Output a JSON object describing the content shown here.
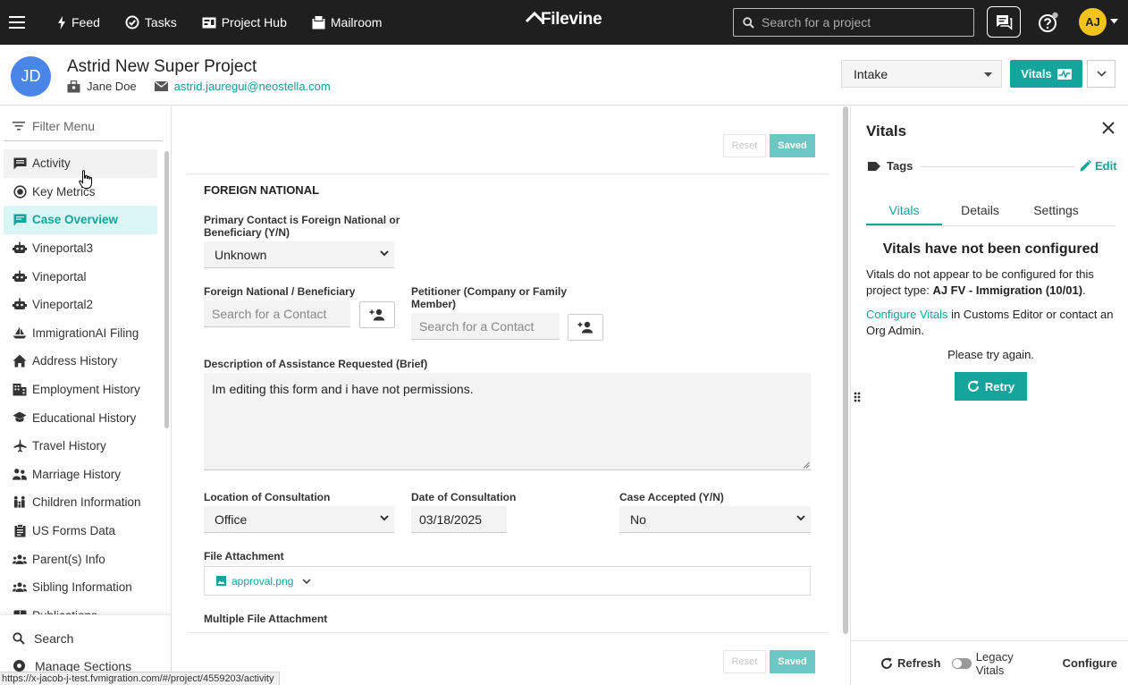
{
  "topnav": {
    "links": [
      {
        "label": "Feed",
        "icon": "bolt-icon"
      },
      {
        "label": "Tasks",
        "icon": "check-circle-icon"
      },
      {
        "label": "Project Hub",
        "icon": "id-card-icon"
      },
      {
        "label": "Mailroom",
        "icon": "mailroom-icon"
      }
    ],
    "logo_text": "Filevine",
    "search_placeholder": "Search for a project",
    "user_initials": "AJ"
  },
  "project": {
    "avatar_initials": "JD",
    "title": "Astrid New Super Project",
    "client": "Jane Doe",
    "email": "astrid.jauregui@neostella.com",
    "phase": "Intake",
    "vitals_button": "Vitals"
  },
  "sidebar": {
    "filter_placeholder": "Filter Menu",
    "items": [
      {
        "label": "Activity",
        "icon": "chat-icon",
        "state": "hover"
      },
      {
        "label": "Key Metrics",
        "icon": "target-icon",
        "state": ""
      },
      {
        "label": "Case Overview",
        "icon": "comment-icon",
        "state": "active"
      },
      {
        "label": "Vineportal3",
        "icon": "robot-icon",
        "state": ""
      },
      {
        "label": "Vineportal",
        "icon": "robot-icon",
        "state": ""
      },
      {
        "label": "Vineportal2",
        "icon": "robot-icon",
        "state": ""
      },
      {
        "label": "ImmigrationAI Filing",
        "icon": "ship-icon",
        "state": ""
      },
      {
        "label": "Address History",
        "icon": "home-icon",
        "state": ""
      },
      {
        "label": "Employment History",
        "icon": "building-icon",
        "state": ""
      },
      {
        "label": "Educational History",
        "icon": "graduation-cap-icon",
        "state": ""
      },
      {
        "label": "Travel History",
        "icon": "airplane-icon",
        "state": ""
      },
      {
        "label": "Marriage History",
        "icon": "people-icon",
        "state": ""
      },
      {
        "label": "Children Information",
        "icon": "family-icon",
        "state": ""
      },
      {
        "label": "US Forms Data",
        "icon": "clipboard-icon",
        "state": ""
      },
      {
        "label": "Parent(s) Info",
        "icon": "group-icon",
        "state": ""
      },
      {
        "label": "Sibling Information",
        "icon": "group-icon",
        "state": ""
      },
      {
        "label": "Publications",
        "icon": "book-icon",
        "state": ""
      }
    ],
    "bottom": {
      "search_label": "Search",
      "manage_label": "Manage Sections"
    }
  },
  "form": {
    "reset_label": "Reset",
    "saved_label": "Saved",
    "section_title": "FOREIGN NATIONAL",
    "primary_contact_label": "Primary Contact is Foreign National or Beneficiary (Y/N)",
    "primary_contact_value": "Unknown",
    "foreign_national_label": "Foreign National / Beneficiary",
    "foreign_national_placeholder": "Search for a Contact",
    "petitioner_label": "Petitioner (Company or Family Member)",
    "petitioner_placeholder": "Search for a Contact",
    "description_label": "Description of Assistance Requested (Brief)",
    "description_value": "Im editing this form and i have not permissions.",
    "location_label": "Location of Consultation",
    "location_value": "Office",
    "date_label": "Date of Consultation",
    "date_value": "03/18/2025",
    "case_accepted_label": "Case Accepted (Y/N)",
    "case_accepted_value": "No",
    "file_attachment_label": "File Attachment",
    "file_attachment_name": "approval.png",
    "multiple_attachment_label": "Multiple File Attachment"
  },
  "vitals_panel": {
    "title": "Vitals",
    "tags_label": "Tags",
    "edit_label": "Edit",
    "tabs": [
      "Vitals",
      "Details",
      "Settings"
    ],
    "active_tab": "Vitals",
    "heading": "Vitals have not been configured",
    "message_prefix": "Vitals do not appear to be configured for this project type: ",
    "project_type": "AJ FV - Immigration (10/01)",
    "message_suffix": ".",
    "configure_link": "Configure Vitals",
    "configure_rest": " in Customs Editor or contact an Org Admin.",
    "try_again": "Please try again.",
    "retry_label": "Retry",
    "footer": {
      "refresh_label": "Refresh",
      "legacy_label": "Legacy Vitals",
      "configure_label": "Configure"
    }
  },
  "statusbar_url": "https://x-jacob-j-test.fvmigration.com/#/project/4559203/activity",
  "colors": {
    "accent": "#14a49c",
    "topbar": "#1f1f1f",
    "avatar_project": "#4a86e8",
    "avatar_user": "#f2c318"
  }
}
